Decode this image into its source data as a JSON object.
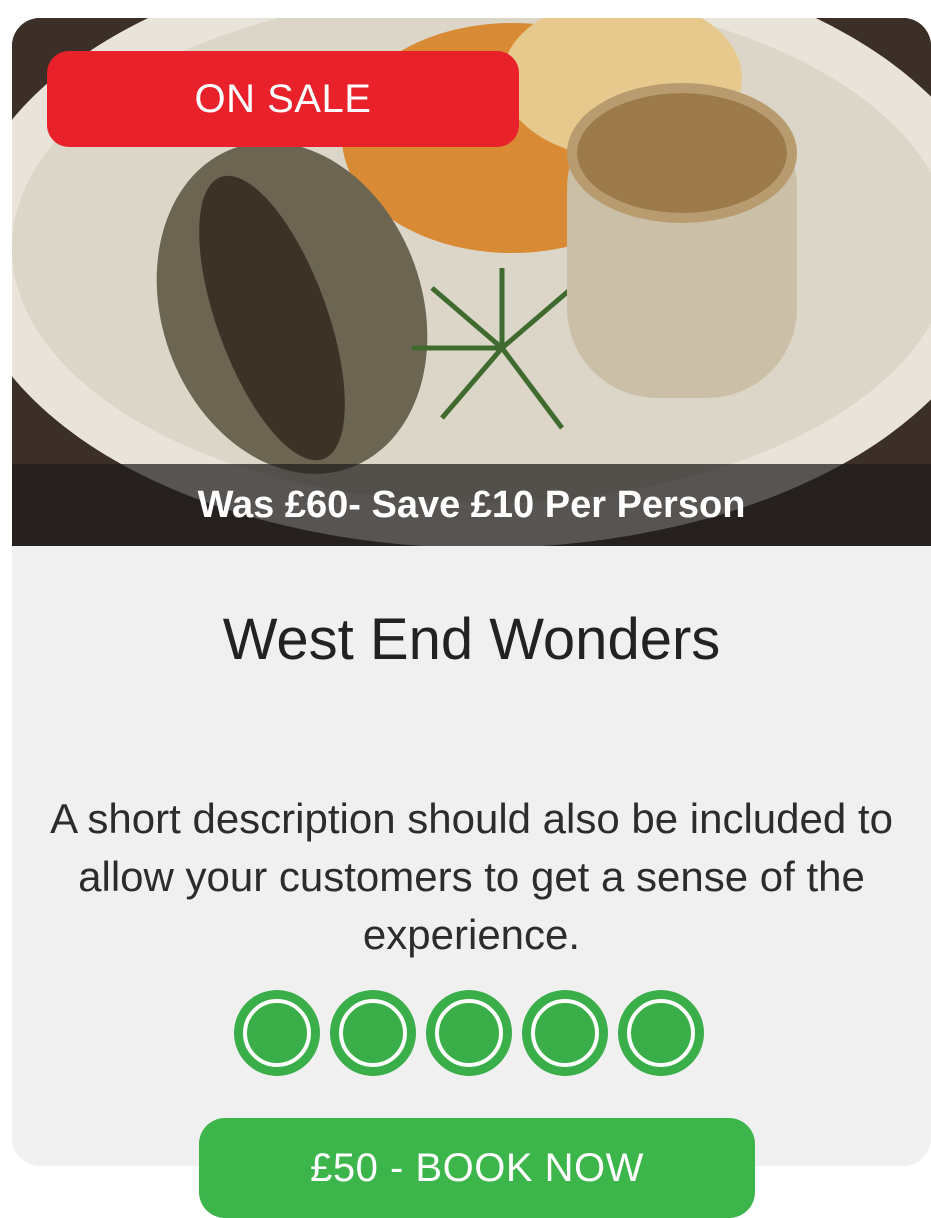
{
  "badge": {
    "label": "ON SALE",
    "color": "#e8212a"
  },
  "promo": {
    "text": "Was £60- Save £10 Per Person"
  },
  "card": {
    "title": "West End Wonders",
    "description": "A short description should also be included to allow your customers to get a sense of the experience."
  },
  "rating": {
    "value": 5,
    "max": 5,
    "icon": "circle-rating-icon",
    "color": "#3aae48"
  },
  "cta": {
    "label": "£50 - BOOK NOW",
    "color": "#3cb54a"
  },
  "photo": {
    "icon": "food-photo"
  }
}
